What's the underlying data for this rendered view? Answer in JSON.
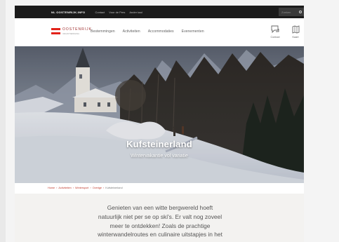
{
  "topbar": {
    "brand": "NL OOSTENRIJK.INFO",
    "links": [
      "Contact",
      "Voor de Pers",
      "Ander taal"
    ],
    "search_placeholder": "Zoeken"
  },
  "header": {
    "logo_name": "OOSTENRIJK",
    "logo_sub": "VAKANTIEPAGINA",
    "nav": [
      "Bestemmingen",
      "Activiteiten",
      "Accommodaties",
      "Evenementen"
    ],
    "icon_contact_label": "Contact",
    "icon_map_label": "Kaart"
  },
  "hero": {
    "title": "Kufsteinerland",
    "subtitle": "Wintervakantie vol variatie"
  },
  "breadcrumb": {
    "items": [
      "Home",
      "Activiteiten",
      "Wintersport",
      "Overige",
      "Kufsteinerland"
    ]
  },
  "intro": {
    "lines": [
      "Genieten van een witte bergwereld hoeft",
      "natuurlijk niet per se op ski's. Er valt nog zoveel",
      "meer te ontdekken! Zoals de prachtige",
      "winterwandelroutes en culinaire uitstapjes in het"
    ]
  },
  "colors": {
    "topbar": "#1b1b1b",
    "accent_red": "#c0392b",
    "content_bg": "#f3f2f0"
  }
}
